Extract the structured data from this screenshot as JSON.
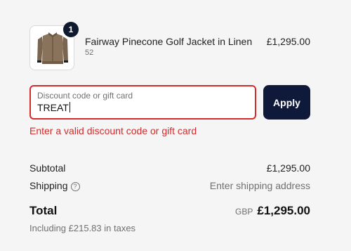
{
  "line_item": {
    "quantity": "1",
    "name": "Fairway Pinecone Golf Jacket in Linen",
    "variant": "52",
    "price": "£1,295.00",
    "image_icon": "jacket-thumbnail"
  },
  "discount": {
    "label": "Discount code or gift card",
    "value": "TREAT",
    "apply_label": "Apply",
    "error": "Enter a valid discount code or gift card"
  },
  "summary": {
    "subtotal_label": "Subtotal",
    "subtotal_value": "£1,295.00",
    "shipping_label": "Shipping",
    "shipping_value": "Enter shipping address",
    "help_icon_glyph": "?",
    "total_label": "Total",
    "currency": "GBP",
    "total_value": "£1,295.00",
    "tax_note": "Including £215.83 in taxes"
  },
  "colors": {
    "error": "#d42b2b",
    "primary_button": "#0f1a3a",
    "badge": "#0f1a2e"
  }
}
